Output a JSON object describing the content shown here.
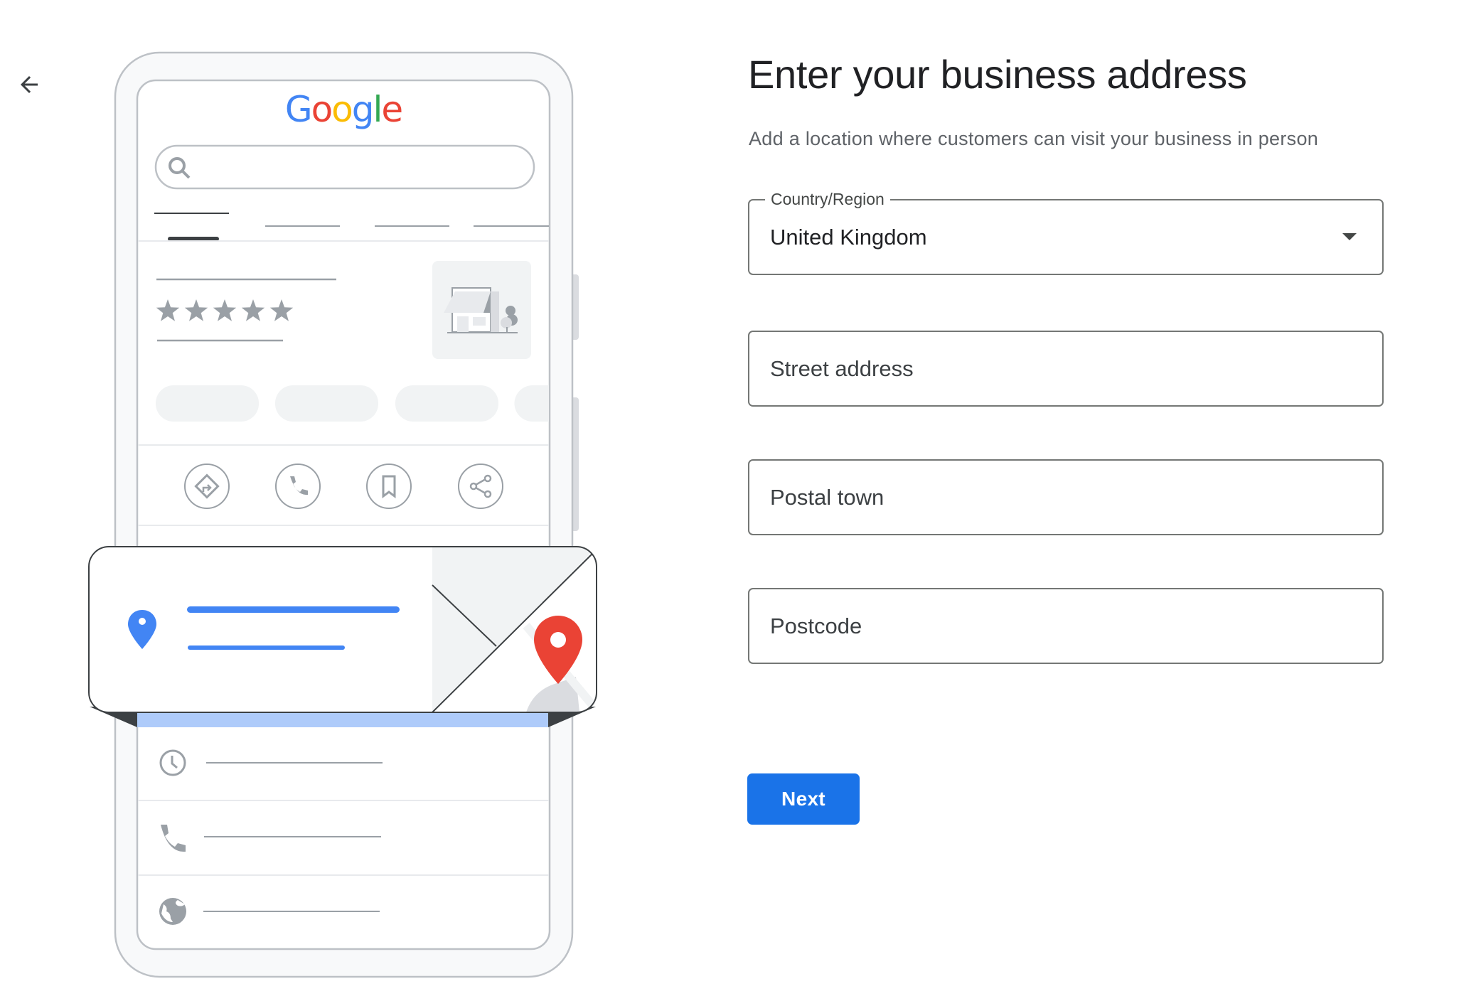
{
  "navigation": {
    "back_icon": "arrow-back-icon",
    "back_label": "Back"
  },
  "illustration": {
    "logo": {
      "letters": [
        "G",
        "o",
        "o",
        "g",
        "l",
        "e"
      ],
      "colors": [
        "#4285f4",
        "#ea4335",
        "#fbbc04",
        "#4285f4",
        "#34a853",
        "#ea4335"
      ]
    },
    "search_icon": "search-icon",
    "rating_stars": 5,
    "action_icons": [
      "directions-icon",
      "call-icon",
      "bookmark-icon",
      "share-icon"
    ],
    "info_icons": [
      "clock-icon",
      "phone-icon",
      "globe-icon"
    ],
    "card_pin_color": "#4285f4",
    "map_pin_color": "#ea4335",
    "highlight_color": "#aecbfa"
  },
  "header": {
    "title": "Enter your business address",
    "subtitle": "Add a location where customers can visit your business in person"
  },
  "form": {
    "country": {
      "label": "Country/Region",
      "value": "United Kingdom",
      "icon": "dropdown-arrow-icon"
    },
    "street": {
      "placeholder": "Street address",
      "value": ""
    },
    "town": {
      "placeholder": "Postal town",
      "value": ""
    },
    "postcode": {
      "placeholder": "Postcode",
      "value": ""
    }
  },
  "actions": {
    "next_label": "Next"
  },
  "colors": {
    "primary": "#1a73e8",
    "title_text": "#202124",
    "secondary_text": "#5f6368",
    "outline": "#747775"
  }
}
